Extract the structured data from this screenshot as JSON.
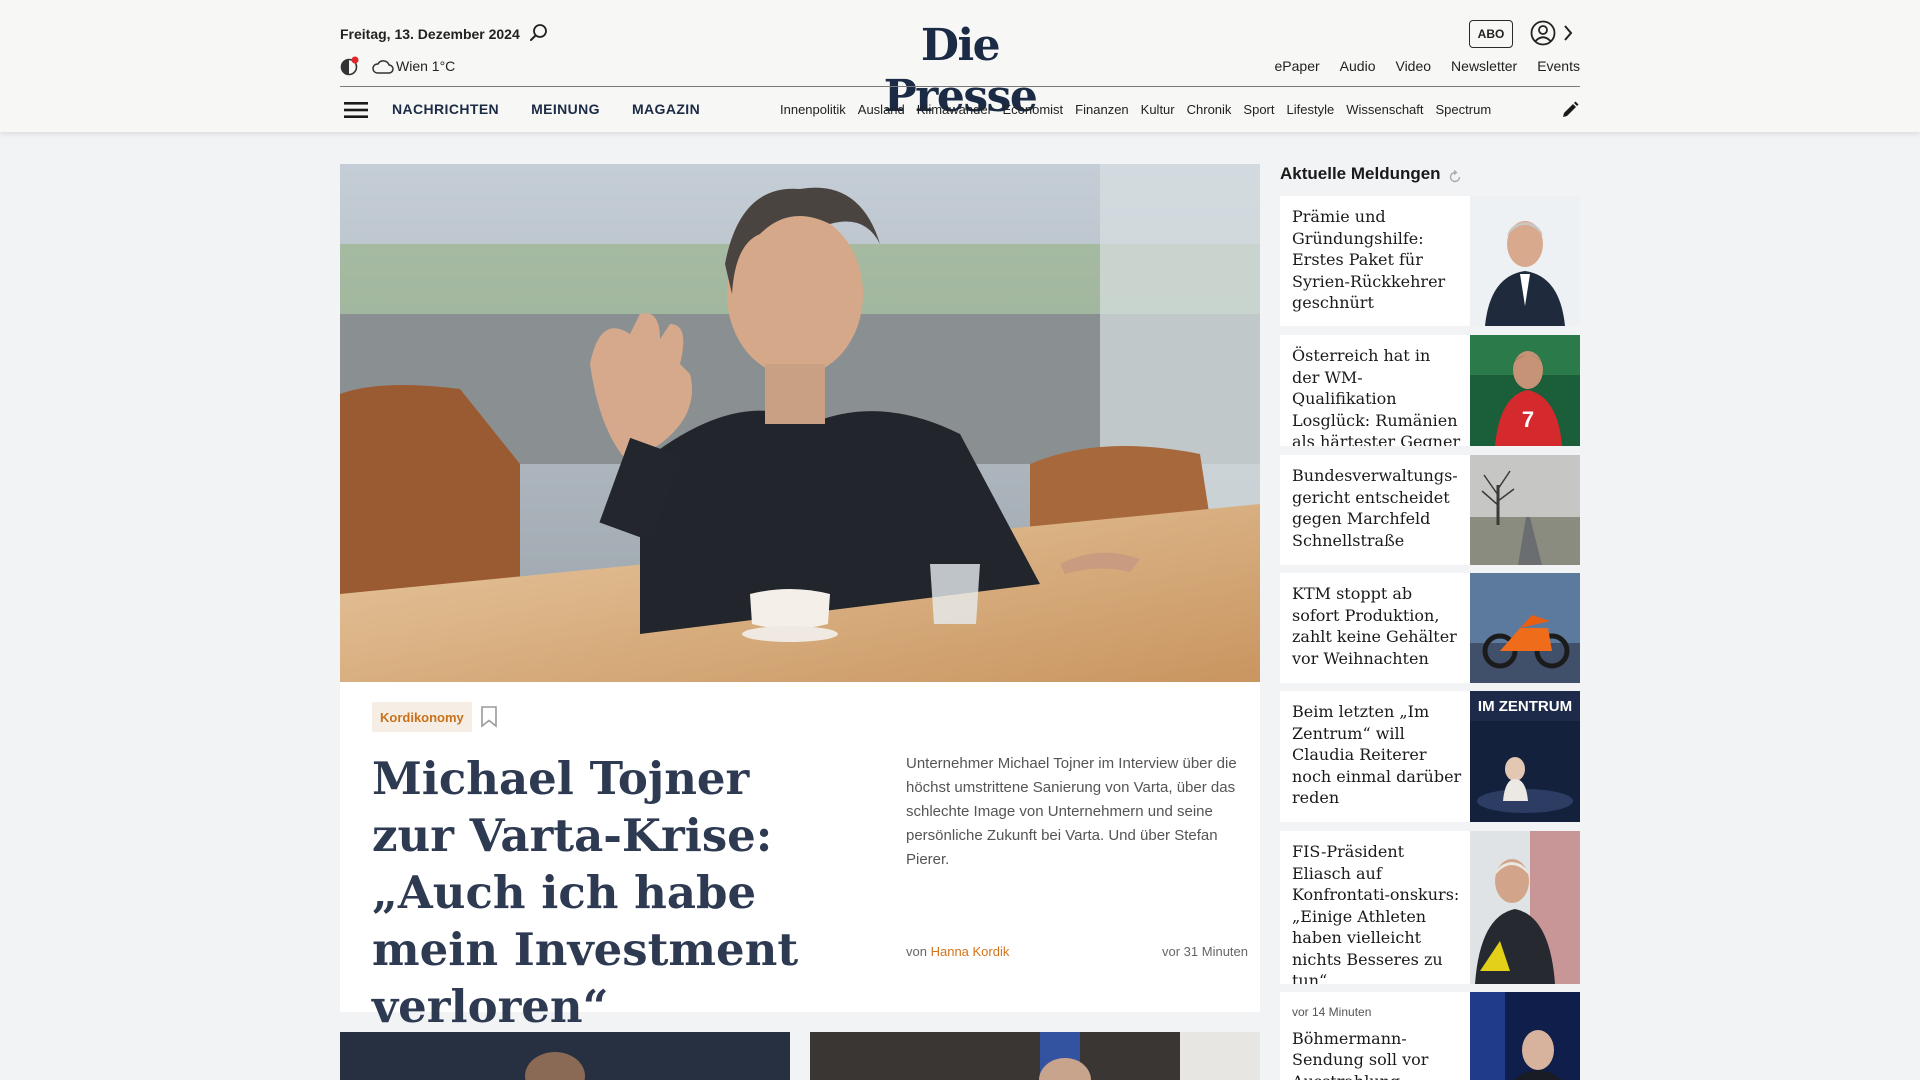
{
  "header": {
    "date": "Freitag, 13. Dezember 2024",
    "weather": "Wien 1°C",
    "logo": "Die Presse",
    "abo_label": "ABO",
    "top_links": [
      "ePaper",
      "Audio",
      "Video",
      "Newsletter",
      "Events"
    ],
    "main_nav": [
      "NACHRICHTEN",
      "MEINUNG",
      "MAGAZIN"
    ],
    "sub_nav": [
      "Innenpolitik",
      "Ausland",
      "Klimawandel",
      "Economist",
      "Finanzen",
      "Kultur",
      "Chronik",
      "Sport",
      "Lifestyle",
      "Wissenschaft",
      "Spectrum"
    ],
    "icons": [
      "search-icon",
      "theme-toggle-icon",
      "cloud-icon",
      "user-icon",
      "chevron-right-icon",
      "menu-icon",
      "pencil-icon"
    ]
  },
  "lead": {
    "category": "Kordikonomy",
    "headline": "Michael Tojner zur Varta-Krise: „Auch ich habe mein Investment verloren“",
    "teaser": "Unternehmer Michael Tojner im Interview über die höchst umstrittene Sanierung von Varta, über das schlechte Image von Unternehmern und seine persönliche Zukunft bei Varta. Und über Stefan Pierer.",
    "byline_prefix": "von",
    "author": "Hanna Kordik",
    "time": "vor 31 Minuten"
  },
  "sidebar": {
    "title": "Aktuelle Meldungen",
    "items": [
      {
        "title": "Prämie und Gründungshilfe: Erstes Paket für Syrien-Rückkehrer geschnürt",
        "time": ""
      },
      {
        "title": "Österreich hat in der WM-Qualifikation Losglück: Rumänien als härtester Gegner",
        "time": ""
      },
      {
        "title": "Bundesverwaltungs-gericht entscheidet gegen Marchfeld Schnellstraße",
        "time": ""
      },
      {
        "title": "KTM stoppt ab sofort Produktion, zahlt keine Gehälter vor Weihnachten",
        "time": ""
      },
      {
        "title": "Beim letzten „Im Zentrum“ will Claudia Reiterer noch einmal darüber reden",
        "time": "",
        "thumb_text": "IM ZENTRUM"
      },
      {
        "title": "FIS-Präsident Eliasch auf Konfrontati-onskurs: „Einige Athleten haben vielleicht nichts Besseres zu tun“",
        "time": ""
      },
      {
        "title": "Böhmermann-Sendung soll vor Ausstrahlung",
        "time": "vor 14 Minuten"
      }
    ]
  },
  "colors": {
    "brand_navy": "#1c2b45",
    "accent_orange": "#d3741c",
    "badge_bg": "#f6eee5",
    "page_bg": "#f2f3f5"
  }
}
